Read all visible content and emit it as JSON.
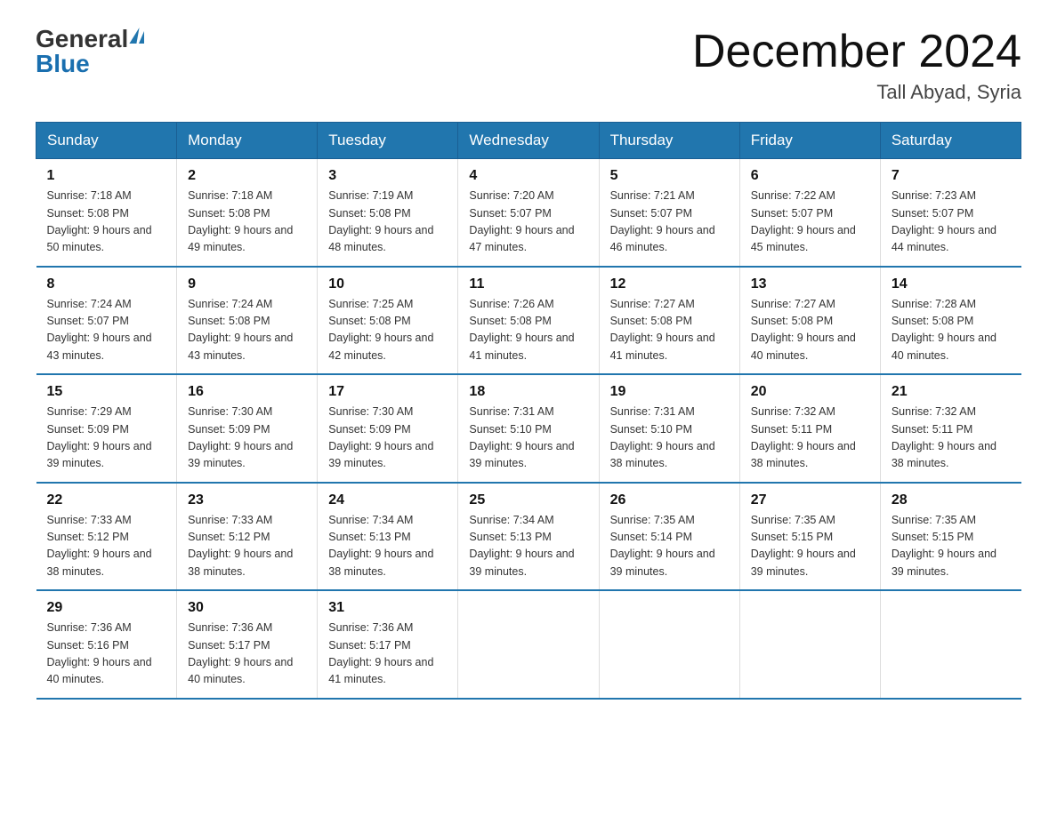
{
  "logo": {
    "general": "General",
    "blue": "Blue"
  },
  "header": {
    "month_year": "December 2024",
    "location": "Tall Abyad, Syria"
  },
  "columns": [
    "Sunday",
    "Monday",
    "Tuesday",
    "Wednesday",
    "Thursday",
    "Friday",
    "Saturday"
  ],
  "weeks": [
    [
      {
        "day": "1",
        "sunrise": "7:18 AM",
        "sunset": "5:08 PM",
        "daylight": "9 hours and 50 minutes."
      },
      {
        "day": "2",
        "sunrise": "7:18 AM",
        "sunset": "5:08 PM",
        "daylight": "9 hours and 49 minutes."
      },
      {
        "day": "3",
        "sunrise": "7:19 AM",
        "sunset": "5:08 PM",
        "daylight": "9 hours and 48 minutes."
      },
      {
        "day": "4",
        "sunrise": "7:20 AM",
        "sunset": "5:07 PM",
        "daylight": "9 hours and 47 minutes."
      },
      {
        "day": "5",
        "sunrise": "7:21 AM",
        "sunset": "5:07 PM",
        "daylight": "9 hours and 46 minutes."
      },
      {
        "day": "6",
        "sunrise": "7:22 AM",
        "sunset": "5:07 PM",
        "daylight": "9 hours and 45 minutes."
      },
      {
        "day": "7",
        "sunrise": "7:23 AM",
        "sunset": "5:07 PM",
        "daylight": "9 hours and 44 minutes."
      }
    ],
    [
      {
        "day": "8",
        "sunrise": "7:24 AM",
        "sunset": "5:07 PM",
        "daylight": "9 hours and 43 minutes."
      },
      {
        "day": "9",
        "sunrise": "7:24 AM",
        "sunset": "5:08 PM",
        "daylight": "9 hours and 43 minutes."
      },
      {
        "day": "10",
        "sunrise": "7:25 AM",
        "sunset": "5:08 PM",
        "daylight": "9 hours and 42 minutes."
      },
      {
        "day": "11",
        "sunrise": "7:26 AM",
        "sunset": "5:08 PM",
        "daylight": "9 hours and 41 minutes."
      },
      {
        "day": "12",
        "sunrise": "7:27 AM",
        "sunset": "5:08 PM",
        "daylight": "9 hours and 41 minutes."
      },
      {
        "day": "13",
        "sunrise": "7:27 AM",
        "sunset": "5:08 PM",
        "daylight": "9 hours and 40 minutes."
      },
      {
        "day": "14",
        "sunrise": "7:28 AM",
        "sunset": "5:08 PM",
        "daylight": "9 hours and 40 minutes."
      }
    ],
    [
      {
        "day": "15",
        "sunrise": "7:29 AM",
        "sunset": "5:09 PM",
        "daylight": "9 hours and 39 minutes."
      },
      {
        "day": "16",
        "sunrise": "7:30 AM",
        "sunset": "5:09 PM",
        "daylight": "9 hours and 39 minutes."
      },
      {
        "day": "17",
        "sunrise": "7:30 AM",
        "sunset": "5:09 PM",
        "daylight": "9 hours and 39 minutes."
      },
      {
        "day": "18",
        "sunrise": "7:31 AM",
        "sunset": "5:10 PM",
        "daylight": "9 hours and 39 minutes."
      },
      {
        "day": "19",
        "sunrise": "7:31 AM",
        "sunset": "5:10 PM",
        "daylight": "9 hours and 38 minutes."
      },
      {
        "day": "20",
        "sunrise": "7:32 AM",
        "sunset": "5:11 PM",
        "daylight": "9 hours and 38 minutes."
      },
      {
        "day": "21",
        "sunrise": "7:32 AM",
        "sunset": "5:11 PM",
        "daylight": "9 hours and 38 minutes."
      }
    ],
    [
      {
        "day": "22",
        "sunrise": "7:33 AM",
        "sunset": "5:12 PM",
        "daylight": "9 hours and 38 minutes."
      },
      {
        "day": "23",
        "sunrise": "7:33 AM",
        "sunset": "5:12 PM",
        "daylight": "9 hours and 38 minutes."
      },
      {
        "day": "24",
        "sunrise": "7:34 AM",
        "sunset": "5:13 PM",
        "daylight": "9 hours and 38 minutes."
      },
      {
        "day": "25",
        "sunrise": "7:34 AM",
        "sunset": "5:13 PM",
        "daylight": "9 hours and 39 minutes."
      },
      {
        "day": "26",
        "sunrise": "7:35 AM",
        "sunset": "5:14 PM",
        "daylight": "9 hours and 39 minutes."
      },
      {
        "day": "27",
        "sunrise": "7:35 AM",
        "sunset": "5:15 PM",
        "daylight": "9 hours and 39 minutes."
      },
      {
        "day": "28",
        "sunrise": "7:35 AM",
        "sunset": "5:15 PM",
        "daylight": "9 hours and 39 minutes."
      }
    ],
    [
      {
        "day": "29",
        "sunrise": "7:36 AM",
        "sunset": "5:16 PM",
        "daylight": "9 hours and 40 minutes."
      },
      {
        "day": "30",
        "sunrise": "7:36 AM",
        "sunset": "5:17 PM",
        "daylight": "9 hours and 40 minutes."
      },
      {
        "day": "31",
        "sunrise": "7:36 AM",
        "sunset": "5:17 PM",
        "daylight": "9 hours and 41 minutes."
      },
      null,
      null,
      null,
      null
    ]
  ]
}
